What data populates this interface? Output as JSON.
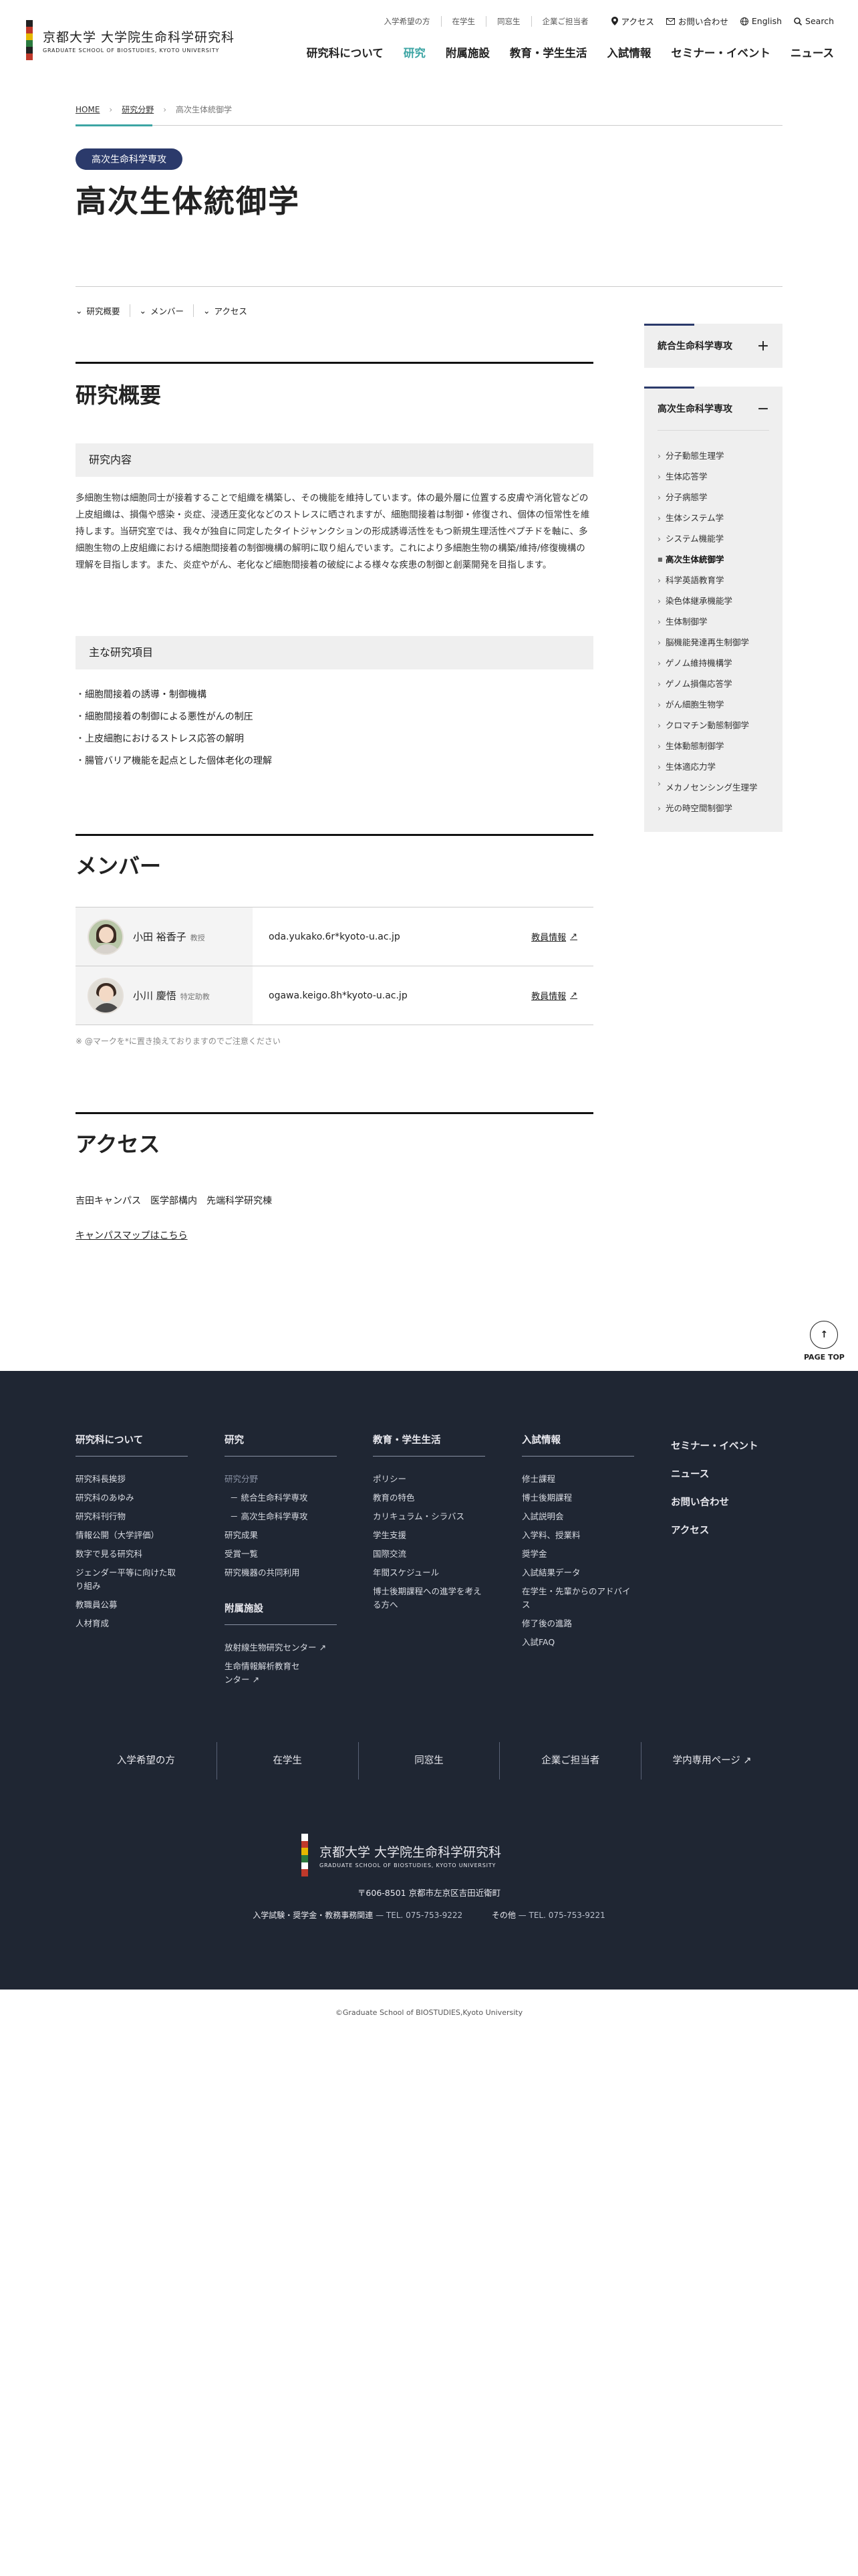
{
  "header": {
    "logo_ja": "京都大学 大学院生命科学研究科",
    "logo_en": "GRADUATE SCHOOL OF BIOSTUDIES, KYOTO UNIVERSITY",
    "utility_links": [
      "入学希望の方",
      "在学生",
      "同窓生",
      "企業ご担当者"
    ],
    "access": "アクセス",
    "contact": "お問い合わせ",
    "english": "English",
    "search": "Search",
    "gnav": [
      "研究科について",
      "研究",
      "附属施設",
      "教育・学生生活",
      "入試情報",
      "セミナー・イベント",
      "ニュース"
    ]
  },
  "breadcrumb": [
    "HOME",
    "研究分野",
    "高次生体統御学"
  ],
  "dept_badge": "高次生命科学専攻",
  "page_title": "高次生体統御学",
  "anchors": [
    "研究概要",
    "メンバー",
    "アクセス"
  ],
  "overview": {
    "heading": "研究概要",
    "content_heading": "研究内容",
    "content_text": "多細胞生物は細胞同士が接着することで組織を構築し、その機能を維持しています。体の最外層に位置する皮膚や消化管などの上皮組織は、損傷や感染・炎症、浸透圧変化などのストレスに晒されますが、細胞間接着は制御・修復され、個体の恒常性を維持します。当研究室では、我々が独自に同定したタイトジャンクションの形成誘導活性をもつ新規生理活性ペプチドを軸に、多細胞生物の上皮組織における細胞間接着の制御機構の解明に取り組んでいます。これにより多細胞生物の構築/維持/修復機構の理解を目指します。また、炎症やがん、老化など細胞間接着の破綻による様々な疾患の制御と創薬開発を目指します。",
    "items_heading": "主な研究項目",
    "items": [
      "細胞間接着の誘導・制御機構",
      "細胞間接着の制御による悪性がんの制圧",
      "上皮細胞におけるストレス応答の解明",
      "腸管バリア機能を起点とした個体老化の理解"
    ]
  },
  "members": {
    "heading": "メンバー",
    "rows": [
      {
        "name": "小田 裕香子",
        "role": "教授",
        "email": "oda.yukako.6r*kyoto-u.ac.jp",
        "link": "教員情報"
      },
      {
        "name": "小川 慶悟",
        "role": "特定助教",
        "email": "ogawa.keigo.8h*kyoto-u.ac.jp",
        "link": "教員情報"
      }
    ],
    "note": "※ @マークを*に置き換えておりますのでご注意ください"
  },
  "access": {
    "heading": "アクセス",
    "location": "吉田キャンパス　医学部構内　先端科学研究棟",
    "map_link": "キャンパスマップはこちら"
  },
  "sidebar": {
    "box1_title": "統合生命科学専攻",
    "box2_title": "高次生命科学専攻",
    "items": [
      "分子動態生理学",
      "生体応答学",
      "分子病態学",
      "生体システム学",
      "システム機能学",
      "高次生体統御学",
      "科学英語教育学",
      "染色体継承機能学",
      "生体制御学",
      "脳機能発達再生制御学",
      "ゲノム維持機構学",
      "ゲノム損傷応答学",
      "がん細胞生物学",
      "クロマチン動態制御学",
      "生体動態制御学",
      "生体適応力学",
      "メカノセンシング生理学",
      "光の時空間制御学"
    ],
    "current_index": 5
  },
  "page_top": "PAGE TOP",
  "footer": {
    "col1": {
      "title": "研究科について",
      "items": [
        "研究科長挨拶",
        "研究科のあゆみ",
        "研究科刊行物",
        "情報公開（大学評価）",
        "数字で見る研究科",
        "ジェンダー平等に向けた取り組み",
        "教職員公募",
        "人材育成"
      ]
    },
    "col2": {
      "title": "研究",
      "items": [
        "研究分野",
        "－ 統合生命科学専攻",
        "－ 高次生命科学専攻",
        "研究成果",
        "受賞一覧",
        "研究機器の共同利用"
      ],
      "title2": "附属施設",
      "items2": [
        "放射線生物研究センター",
        "生命情報解析教育センター"
      ]
    },
    "col3": {
      "title": "教育・学生生活",
      "items": [
        "ポリシー",
        "教育の特色",
        "カリキュラム・シラバス",
        "学生支援",
        "国際交流",
        "年間スケジュール",
        "博士後期課程への進学を考える方へ"
      ]
    },
    "col4": {
      "title": "入試情報",
      "items": [
        "修士課程",
        "博士後期課程",
        "入試説明会",
        "入学料、授業料",
        "奨学金",
        "入試結果データ",
        "在学生・先輩からのアドバイス",
        "修了後の進路",
        "入試FAQ"
      ]
    },
    "right": [
      "セミナー・イベント",
      "ニュース",
      "お問い合わせ",
      "アクセス"
    ],
    "bottom_links": [
      "入学希望の方",
      "在学生",
      "同窓生",
      "企業ご担当者",
      "学内専用ページ"
    ],
    "logo_ja": "京都大学 大学院生命科学研究科",
    "logo_en": "GRADUATE SCHOOL OF BIOSTUDIES, KYOTO UNIVERSITY",
    "address": "〒606-8501 京都市左京区吉田近衛町",
    "contact1_label": "入学試験・奨学金・教務事務関連",
    "contact1_tel": "TEL. 075-753-9222",
    "contact2_label": "その他",
    "contact2_tel": "TEL. 075-753-9221"
  },
  "copyright": "©Graduate School of BIOSTUDIES,Kyoto University",
  "colors": {
    "accent": "#3da5a4",
    "navy": "#2b3a6b",
    "footer_bg": "#1f2633"
  }
}
